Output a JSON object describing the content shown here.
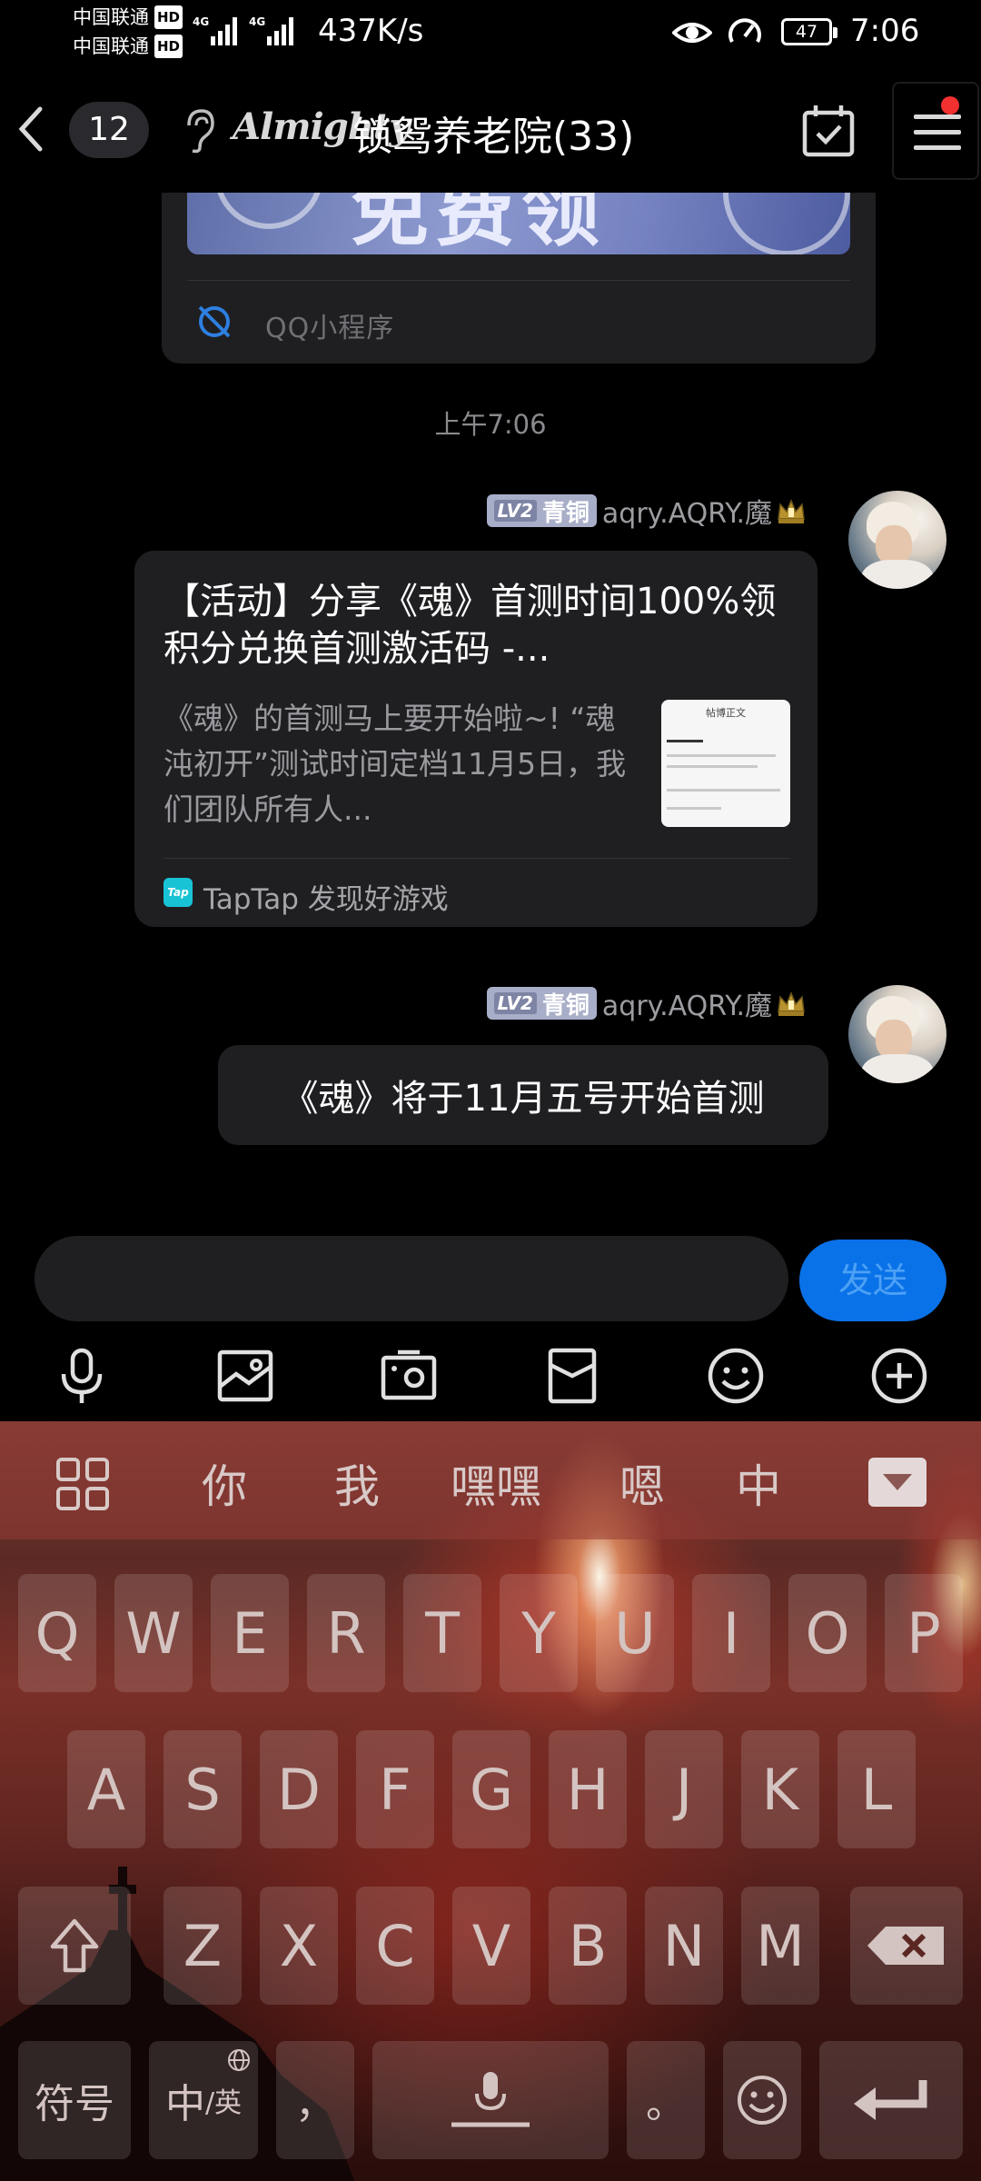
{
  "status_bar": {
    "carrier_1": "中国联通",
    "carrier_2": "中国联通",
    "hd_badge": "HD",
    "network_1": "4G",
    "network_2": "4G",
    "net_speed": "437K/s",
    "battery": "47",
    "time": "7:06"
  },
  "title_bar": {
    "unread_count": "12",
    "brand_text": "Almighty",
    "group_name": "锁鸳养老院(33)",
    "has_notification_dot": true
  },
  "chat": {
    "mini_program_card": {
      "banner_text": "免费领",
      "label": "QQ小程序"
    },
    "timestamp": "上午7:06",
    "messages": [
      {
        "type": "share",
        "sender": {
          "level": "LV2",
          "rank": "青铜",
          "name": "aqry.AQRY.魔"
        },
        "title": "【活动】分享《魂》首测时间100%领积分兑换首测激活码 -...",
        "description": "《魂》的首测马上要开始啦~! “魂沌初开”测试时间定档11月5日，我们团队所有人...",
        "thumb_header": "帖博正文",
        "source_label": "TapTap 发现好游戏",
        "source_icon": "Tap"
      },
      {
        "type": "text",
        "sender": {
          "level": "LV2",
          "rank": "青铜",
          "name": "aqry.AQRY.魔"
        },
        "text": "《魂》将于11月五号开始首测"
      }
    ]
  },
  "input": {
    "value": "",
    "send_label": "发送"
  },
  "toolbar": [
    "mic-icon",
    "image-icon",
    "camera-icon",
    "red-packet-icon",
    "emoji-icon",
    "plus-icon"
  ],
  "keyboard": {
    "candidates": [
      "你",
      "我",
      "嘿嘿",
      "嗯",
      "中"
    ],
    "row1": [
      "Q",
      "W",
      "E",
      "R",
      "T",
      "Y",
      "U",
      "I",
      "O",
      "P"
    ],
    "row2": [
      "A",
      "S",
      "D",
      "F",
      "G",
      "H",
      "J",
      "K",
      "L"
    ],
    "row3": [
      "Z",
      "X",
      "C",
      "V",
      "B",
      "N",
      "M"
    ],
    "symbols_key": "符号",
    "lang_key_main": "中",
    "lang_key_sub": "/英",
    "comma_key": "，",
    "period_key": "。"
  },
  "colors": {
    "background": "#000000",
    "bubble": "#1f1f22",
    "send_button": "#0a72e8",
    "notification_dot": "#f23030",
    "level_badge": "#a8aec8"
  }
}
